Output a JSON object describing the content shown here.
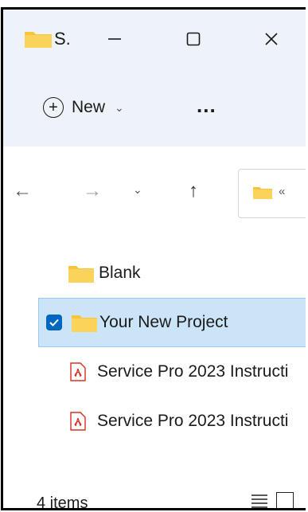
{
  "window": {
    "title": "S."
  },
  "toolbar": {
    "new_label": "New",
    "more_label": "..."
  },
  "files": [
    {
      "name": "Blank",
      "type": "folder",
      "selected": false
    },
    {
      "name": "Your New Project",
      "type": "folder",
      "selected": true
    },
    {
      "name": "Service Pro 2023 Instructi",
      "type": "pdf",
      "selected": false
    },
    {
      "name": "Service Pro 2023 Instructi",
      "type": "pdf",
      "selected": false
    }
  ],
  "address": {
    "separator": "«"
  },
  "status": {
    "item_count": "4 items"
  },
  "colors": {
    "folder": "#f8c53a",
    "selection": "#cce4f7",
    "accent": "#0067c0",
    "pdf": "#d93025"
  }
}
